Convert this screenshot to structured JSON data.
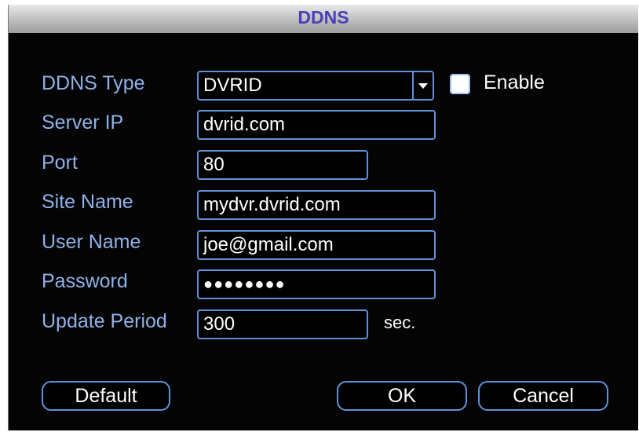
{
  "window": {
    "title": "DDNS"
  },
  "form": {
    "ddns_type": {
      "label": "DDNS Type",
      "value": "DVRID",
      "enable_label": "Enable",
      "enabled": false
    },
    "server_ip": {
      "label": "Server IP",
      "value": "dvrid.com"
    },
    "port": {
      "label": "Port",
      "value": "80"
    },
    "site_name": {
      "label": "Site Name",
      "value": "mydvr.dvrid.com"
    },
    "user_name": {
      "label": "User Name",
      "value": "joe@gmail.com"
    },
    "password": {
      "label": "Password",
      "value": "●●●●●●●●"
    },
    "update_period": {
      "label": "Update Period",
      "value": "300",
      "unit": "sec."
    }
  },
  "buttons": {
    "default_label": "Default",
    "ok_label": "OK",
    "cancel_label": "Cancel"
  },
  "icons": {
    "dropdown": "chevron-down-icon"
  },
  "colors": {
    "background": "#040404",
    "label": "#8fb2e9",
    "border": "#5f93d8",
    "title": "#4a3fb8",
    "value_text": "#ffffff"
  }
}
